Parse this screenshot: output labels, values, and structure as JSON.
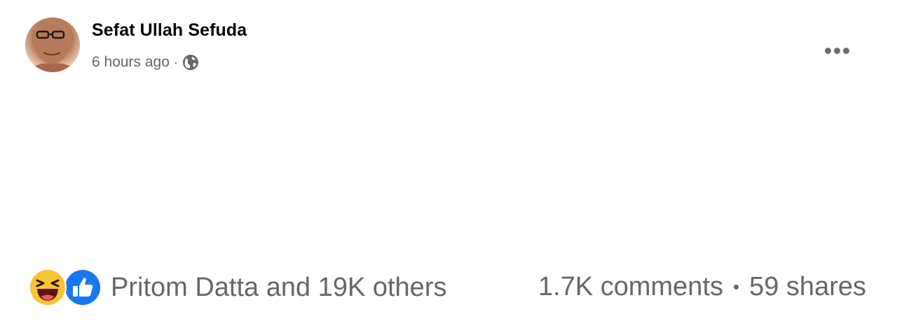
{
  "post": {
    "author": "Sefat Ullah Sefuda",
    "timestamp": "6 hours ago",
    "separator": "·",
    "privacy_icon": "globe-icon",
    "more_icon": "ellipsis-icon"
  },
  "footer": {
    "reaction_icons": [
      "haha-reaction-icon",
      "like-reaction-icon"
    ],
    "reaction_summary": "Pritom Datta and 19K others",
    "comments": "1.7K comments",
    "stats_separator": "•",
    "shares": "59 shares"
  },
  "colors": {
    "text_primary": "#050505",
    "text_secondary": "#65676b",
    "like_blue": "#1877f2",
    "haha_yellow": "#f7c531"
  }
}
